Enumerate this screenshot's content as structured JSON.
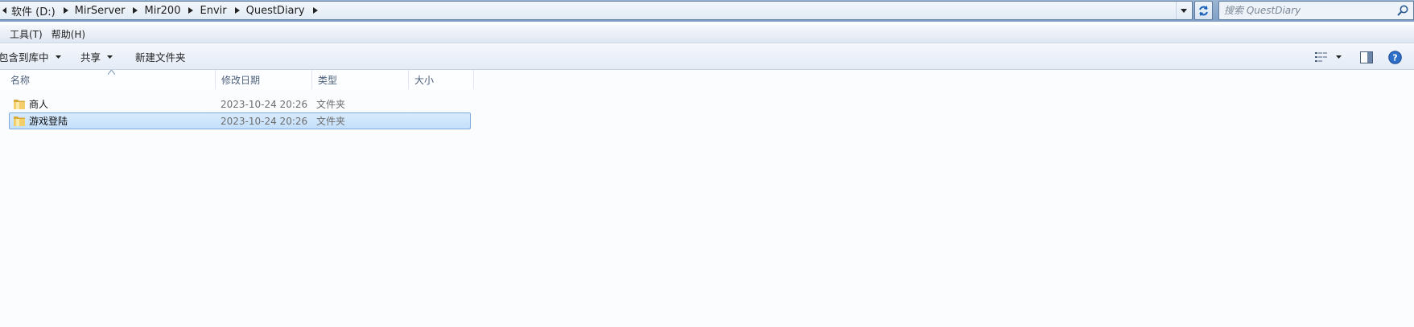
{
  "address_bar": {
    "crumbs": [
      {
        "label": "软件 (D:)"
      },
      {
        "label": "MirServer"
      },
      {
        "label": "Mir200"
      },
      {
        "label": "Envir"
      },
      {
        "label": "QuestDiary"
      }
    ]
  },
  "search": {
    "placeholder": "搜索 QuestDiary"
  },
  "menu": {
    "tools": "工具(T)",
    "help": "帮助(H)"
  },
  "toolbar": {
    "include_in_library": "包含到库中",
    "share": "共享",
    "new_folder": "新建文件夹"
  },
  "columns": {
    "name": "名称",
    "date": "修改日期",
    "type": "类型",
    "size": "大小"
  },
  "files": [
    {
      "name": "商人",
      "date": "2023-10-24 20:26",
      "type": "文件夹",
      "size": "",
      "selected": false
    },
    {
      "name": "游戏登陆",
      "date": "2023-10-24 20:26",
      "type": "文件夹",
      "size": "",
      "selected": true
    }
  ],
  "colors": {
    "selection": "#c4e0fb",
    "selection_border": "#7ea9d8",
    "folder": "#e8c15a"
  },
  "icons": [
    "chevron-right-icon",
    "chevron-down-icon",
    "refresh-icon",
    "search-icon",
    "folder-icon",
    "view-options-icon",
    "preview-pane-icon",
    "help-icon"
  ]
}
